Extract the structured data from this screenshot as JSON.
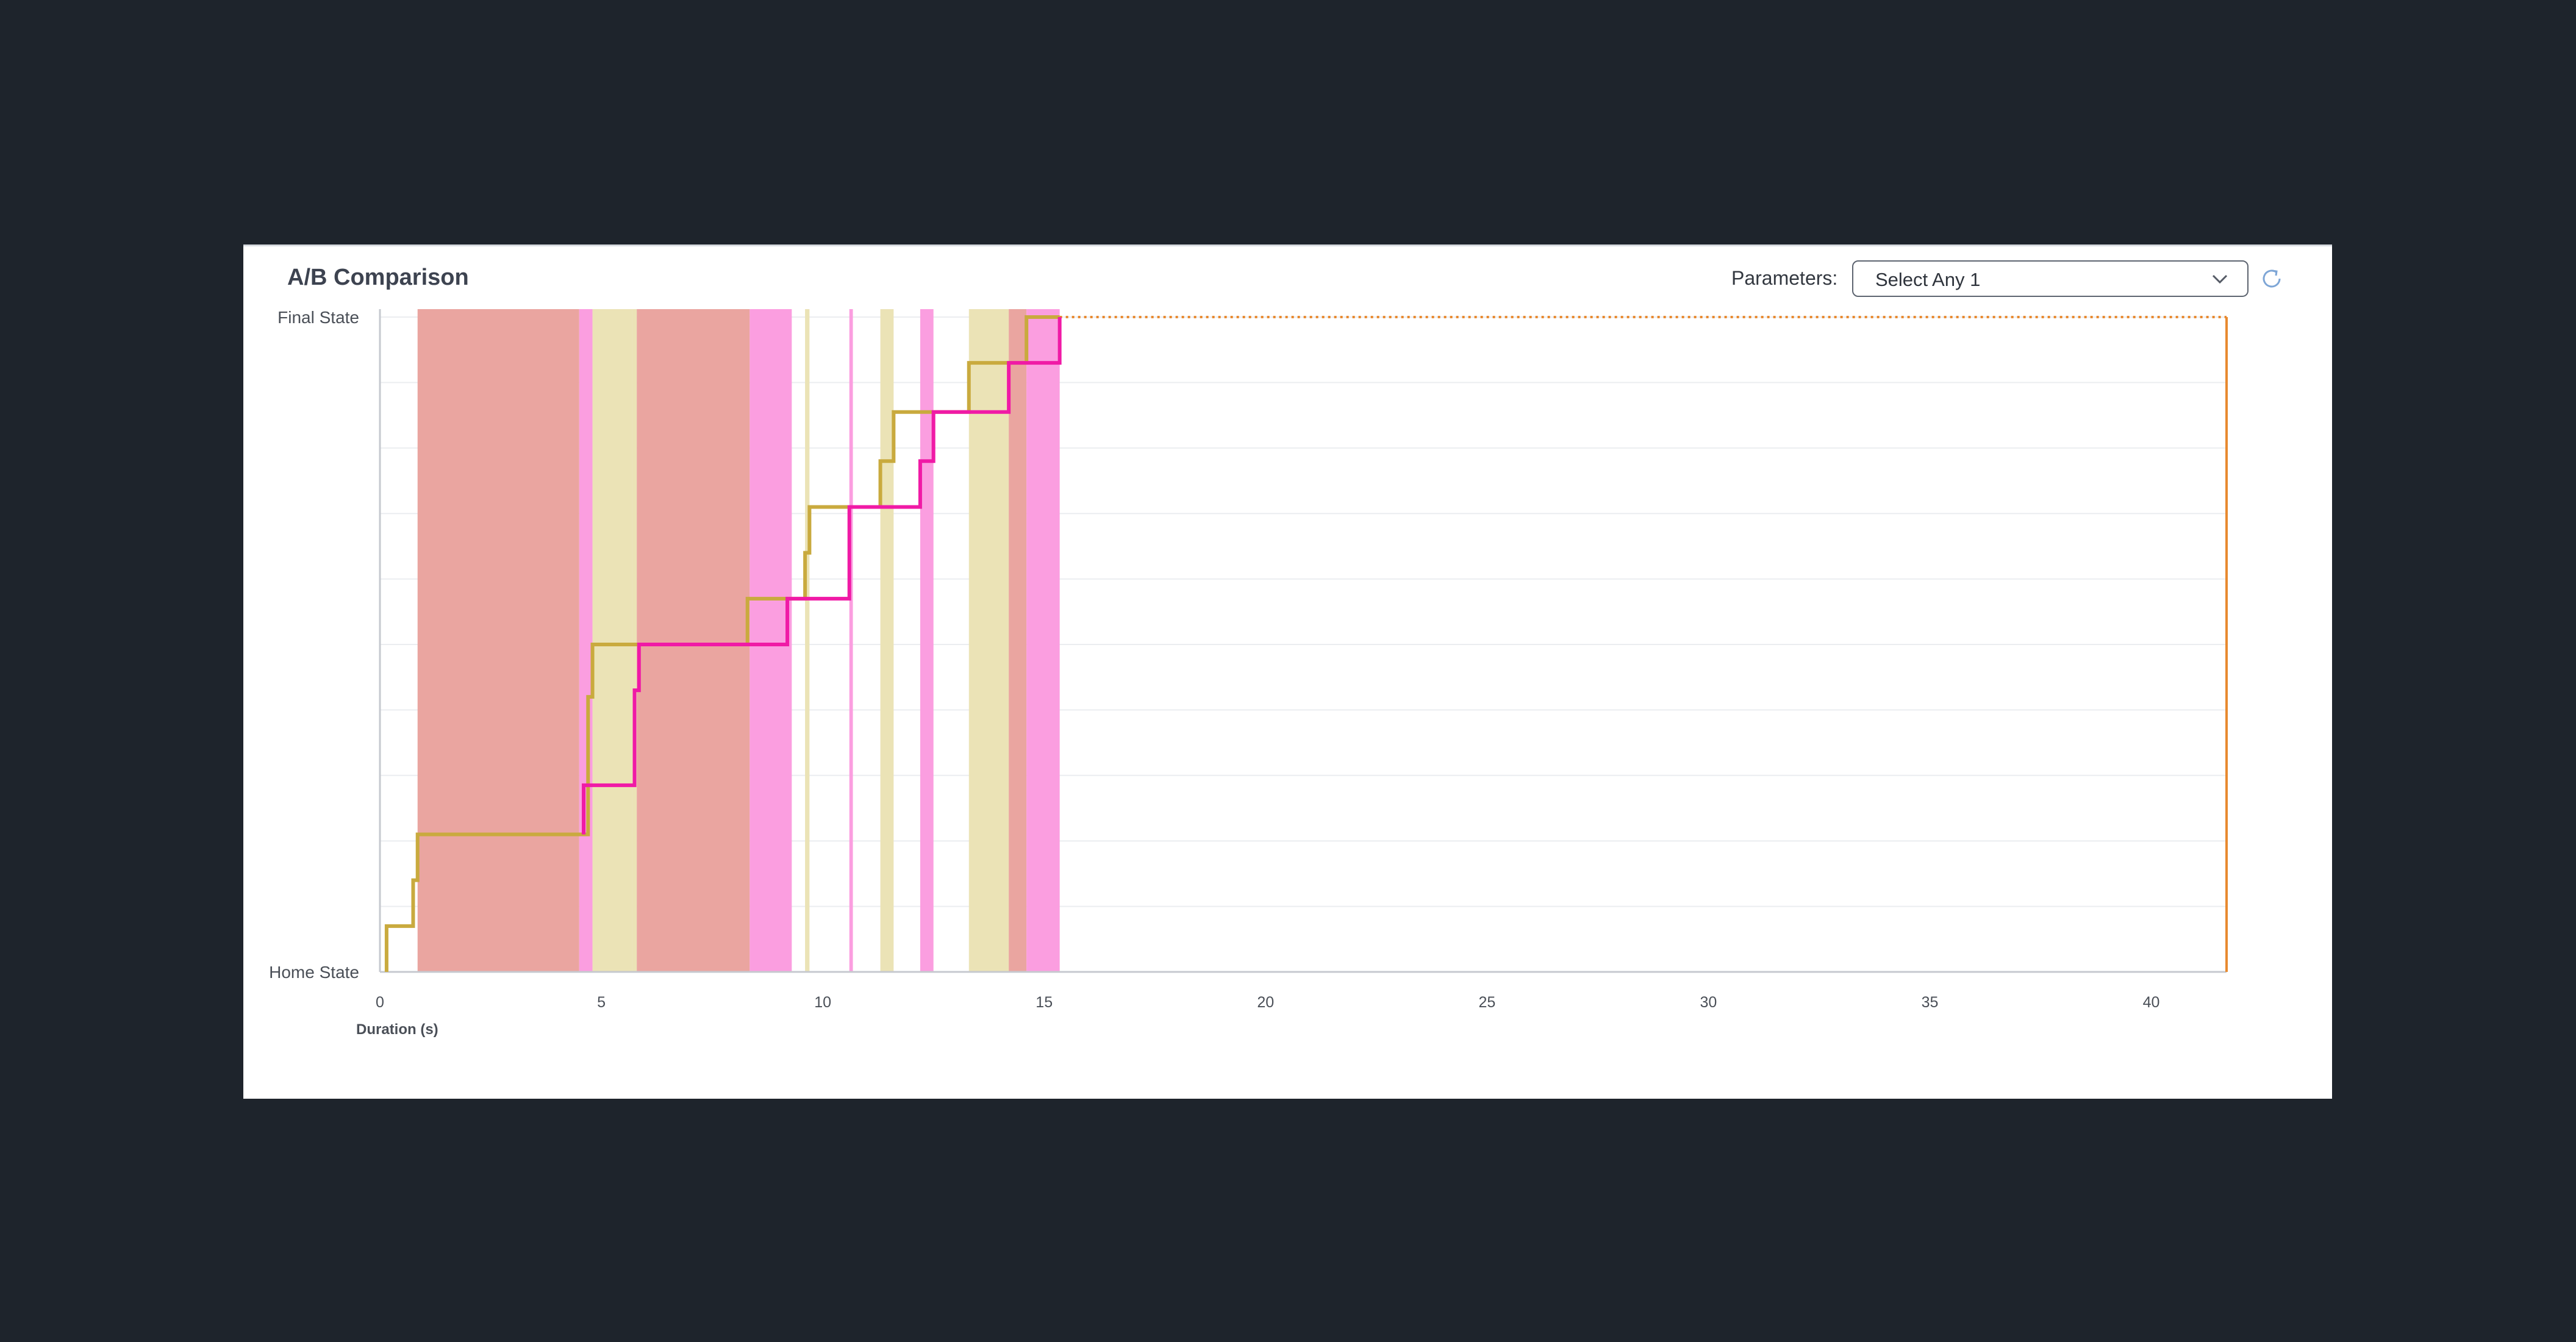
{
  "header": {
    "title": "A/B Comparison",
    "params_label": "Parameters:",
    "select_value": "Select Any 1"
  },
  "icons": {
    "dropdown": "chevron-down-icon",
    "refresh": "refresh-icon"
  },
  "colors": {
    "series_a": "#c9aa3e",
    "series_b": "#f01aa6",
    "band_overlap": "#eaa5a0",
    "band_a": "#ebe3b6",
    "band_b": "#fb9ee0",
    "end_marker": "#e88a30"
  },
  "chart_data": {
    "type": "line",
    "step": true,
    "xlabel": "Duration (s)",
    "ylabel": "",
    "xlim": [
      0,
      41.7
    ],
    "x_ticks": [
      0,
      5,
      10,
      15,
      20,
      25,
      30,
      35,
      40
    ],
    "y_tick_labels": [
      "Home State",
      "Final State"
    ],
    "ylim": [
      0,
      1
    ],
    "grid": "horizontal",
    "series": [
      {
        "color": "#c9aa3e",
        "x": [
          0.15,
          0.15,
          0.75,
          0.75,
          0.85,
          0.85,
          4.7,
          4.7,
          4.8,
          4.8,
          8.3,
          8.3,
          9.6,
          9.6,
          9.7,
          9.7,
          11.3,
          11.3,
          11.6,
          11.6,
          13.3,
          13.3,
          14.6,
          14.6,
          15.35
        ],
        "y": [
          0,
          0.07,
          0.07,
          0.14,
          0.14,
          0.21,
          0.21,
          0.42,
          0.42,
          0.5,
          0.5,
          0.57,
          0.57,
          0.64,
          0.64,
          0.71,
          0.71,
          0.78,
          0.78,
          0.855,
          0.855,
          0.93,
          0.93,
          1,
          1
        ]
      },
      {
        "color": "#f01aa6",
        "x": [
          4.6,
          4.6,
          5.75,
          5.75,
          5.8,
          5.8,
          5.85,
          5.85,
          9.2,
          9.2,
          10.6,
          10.6,
          12.2,
          12.2,
          12.5,
          12.5,
          14.2,
          14.2,
          15.35,
          15.35
        ],
        "y": [
          0.21,
          0.285,
          0.285,
          0.43,
          0.43,
          0.43,
          0.43,
          0.5,
          0.5,
          0.57,
          0.57,
          0.71,
          0.71,
          0.78,
          0.78,
          0.855,
          0.855,
          0.93,
          0.93,
          1
        ]
      }
    ],
    "bands": [
      {
        "x0": 0.85,
        "x1": 4.5,
        "kind": "overlap"
      },
      {
        "x0": 4.5,
        "x1": 4.8,
        "kind": "b"
      },
      {
        "x0": 4.8,
        "x1": 4.95,
        "kind": "a"
      },
      {
        "x0": 4.95,
        "x1": 5.7,
        "kind": "a"
      },
      {
        "x0": 5.7,
        "x1": 5.8,
        "kind": "a"
      },
      {
        "x0": 5.8,
        "x1": 8.35,
        "kind": "overlap"
      },
      {
        "x0": 8.35,
        "x1": 9.3,
        "kind": "b"
      },
      {
        "x0": 9.6,
        "x1": 9.7,
        "kind": "a"
      },
      {
        "x0": 10.6,
        "x1": 10.68,
        "kind": "b"
      },
      {
        "x0": 11.3,
        "x1": 11.6,
        "kind": "a"
      },
      {
        "x0": 12.2,
        "x1": 12.5,
        "kind": "b"
      },
      {
        "x0": 13.3,
        "x1": 14.2,
        "kind": "a"
      },
      {
        "x0": 14.2,
        "x1": 14.6,
        "kind": "overlap"
      },
      {
        "x0": 14.6,
        "x1": 15.35,
        "kind": "b"
      }
    ],
    "end_marker_x": 41.7
  }
}
